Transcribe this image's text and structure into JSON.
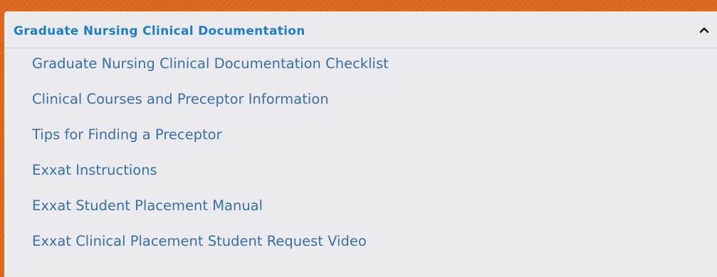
{
  "accordion": {
    "title": "Graduate Nursing Clinical Documentation",
    "toggle_icon": "chevron-up-icon",
    "expanded": true,
    "links": [
      {
        "label": "Graduate Nursing Clinical Documentation Checklist"
      },
      {
        "label": "Clinical Courses and Preceptor Information"
      },
      {
        "label": "Tips for Finding a Preceptor"
      },
      {
        "label": "Exxat Instructions"
      },
      {
        "label": "Exxat Student Placement Manual"
      },
      {
        "label": "Exxat Clinical Placement Student Request Video"
      }
    ]
  },
  "colors": {
    "background": "#d8661c",
    "panel": "#ebebef",
    "title": "#1f7fc4",
    "link": "#3a6fa3"
  }
}
